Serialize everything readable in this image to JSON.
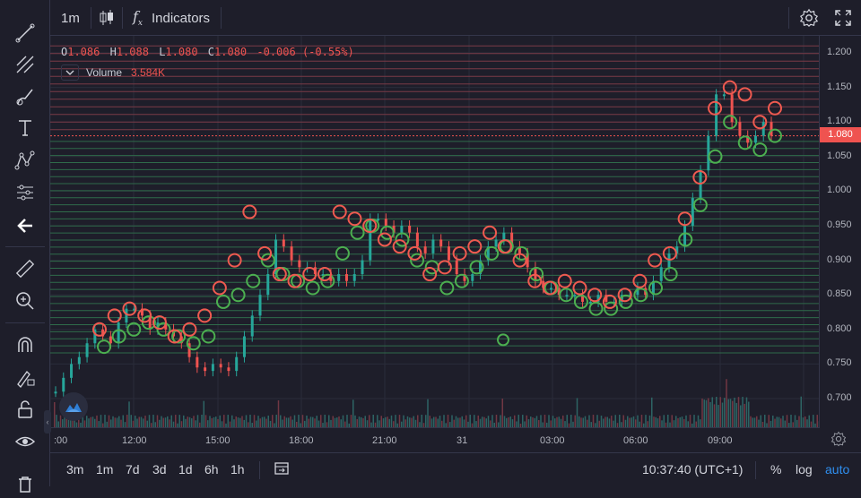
{
  "toolbar": {
    "interval": "1m",
    "indicators_label": "Indicators"
  },
  "legend": {
    "open_label": "O",
    "open": "1.086",
    "high_label": "H",
    "high": "1.088",
    "low_label": "L",
    "low": "1.080",
    "close_label": "C",
    "close": "1.080",
    "change": "-0.006 (-0.55%)",
    "volume_label": "Volume",
    "volume": "3.584K"
  },
  "price_axis": {
    "ticks": [
      "1.200",
      "1.150",
      "1.100",
      "1.050",
      "1.000",
      "0.950",
      "0.900",
      "0.850",
      "0.800",
      "0.750",
      "0.700"
    ],
    "last_price": "1.080"
  },
  "time_axis": {
    "ticks": [
      ":00",
      "12:00",
      "15:00",
      "18:00",
      "21:00",
      "31",
      "03:00",
      "06:00",
      "09:00"
    ]
  },
  "bottom": {
    "ranges": [
      "3m",
      "1m",
      "7d",
      "3d",
      "1d",
      "6h",
      "1h"
    ],
    "clock": "10:37:40 (UTC+1)",
    "percent": "%",
    "log": "log",
    "auto": "auto"
  },
  "colors": {
    "up": "#26a69a",
    "down": "#ef5350",
    "circle_green": "#4caf50",
    "circle_red": "#f05a50",
    "accent": "#2962ff"
  },
  "chart_data": {
    "type": "candlestick",
    "ylim": [
      0.66,
      1.22
    ],
    "price_series": [
      [
        0.71,
        0.73,
        0.75,
        0.76,
        0.78,
        0.8,
        0.79,
        0.78,
        0.81,
        0.83,
        0.83,
        0.82,
        0.8,
        0.81,
        0.8,
        0.79,
        0.78,
        0.76,
        0.745,
        0.74,
        0.75,
        0.745,
        0.74,
        0.76,
        0.79,
        0.82,
        0.85,
        0.88,
        0.93,
        0.92,
        0.9,
        0.89,
        0.89,
        0.88,
        0.88,
        0.87,
        0.88,
        0.87,
        0.88,
        0.9,
        0.96,
        0.96,
        0.95,
        0.94,
        0.95,
        0.94,
        0.92,
        0.91,
        0.93,
        0.92,
        0.9,
        0.88,
        0.87,
        0.88,
        0.9,
        0.92,
        0.93,
        0.94,
        0.92,
        0.91,
        0.89,
        0.87,
        0.86,
        0.86,
        0.85,
        0.85,
        0.85,
        0.84,
        0.84,
        0.85,
        0.84,
        0.84,
        0.85,
        0.85,
        0.86,
        0.85,
        0.87,
        0.89,
        0.91,
        0.92,
        0.95,
        0.99,
        1.03,
        1.08,
        1.14,
        1.14,
        1.1,
        1.08,
        1.07,
        1.08,
        1.1,
        1.08
      ]
    ],
    "circles_green": [
      0.775,
      0.79,
      0.8,
      0.81,
      0.8,
      0.79,
      0.78,
      0.79,
      0.84,
      0.85,
      0.87,
      0.9,
      0.88,
      0.87,
      0.86,
      0.87,
      0.91,
      0.94,
      0.95,
      0.94,
      0.93,
      0.9,
      0.89,
      0.86,
      0.87,
      0.89,
      0.91,
      0.92,
      0.91,
      0.88,
      0.86,
      0.85,
      0.84,
      0.83,
      0.83,
      0.84,
      0.85,
      0.86,
      0.88,
      0.93,
      0.98,
      1.05,
      1.1,
      1.07,
      1.06,
      1.08,
      0.785
    ],
    "circles_red": [
      0.8,
      0.82,
      0.83,
      0.82,
      0.81,
      0.79,
      0.8,
      0.82,
      0.86,
      0.9,
      0.97,
      0.91,
      0.88,
      0.87,
      0.88,
      0.88,
      0.97,
      0.96,
      0.95,
      0.93,
      0.92,
      0.91,
      0.88,
      0.89,
      0.91,
      0.92,
      0.94,
      0.92,
      0.9,
      0.87,
      0.86,
      0.87,
      0.86,
      0.85,
      0.84,
      0.85,
      0.87,
      0.9,
      0.91,
      0.96,
      1.02,
      1.12,
      1.15,
      1.14,
      1.1,
      1.12
    ]
  }
}
